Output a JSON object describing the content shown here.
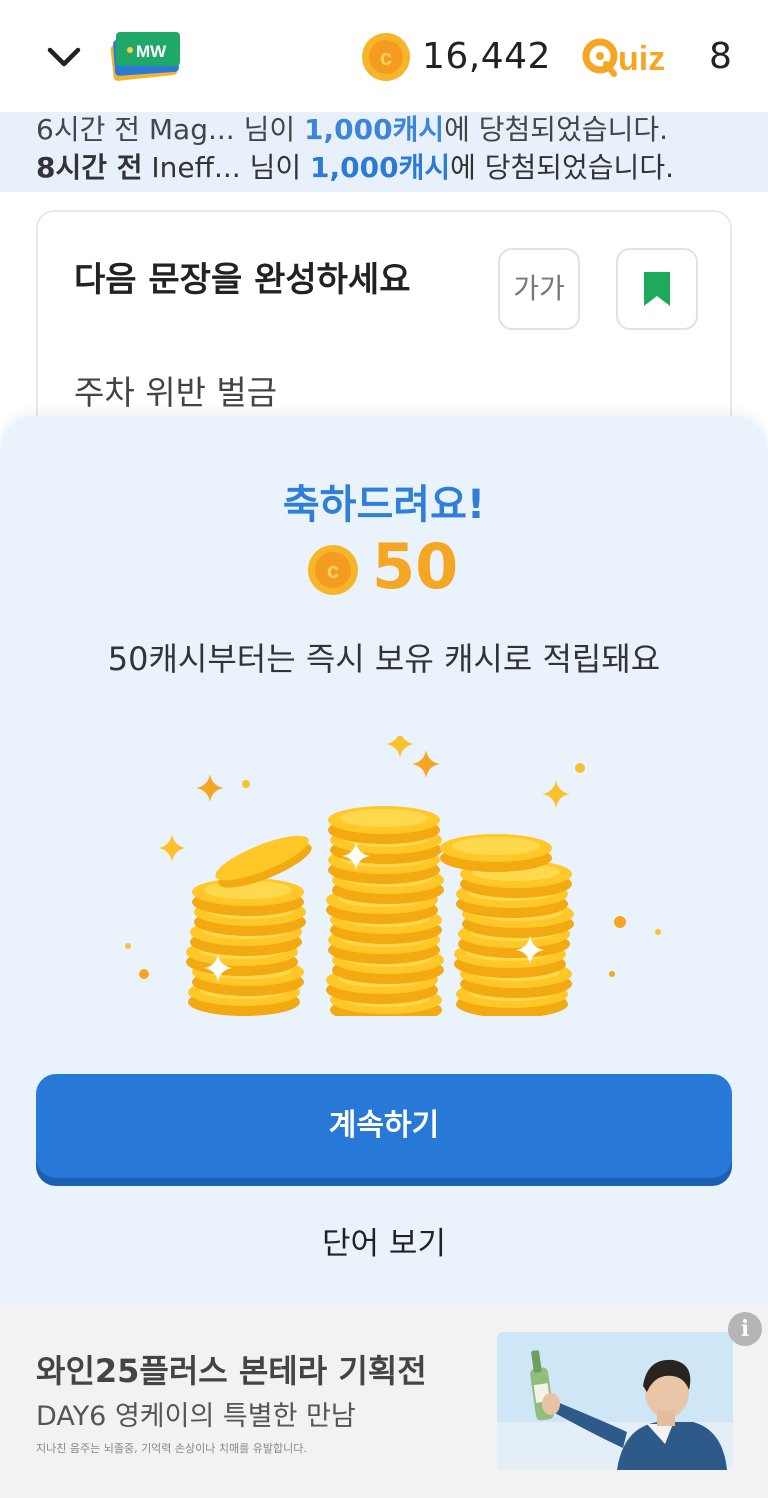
{
  "header": {
    "cash_amount": "16,442",
    "quiz_count": "8",
    "logo_text": "MW",
    "quiz_logo_text": "Quiz",
    "coin_letter": "c"
  },
  "ticker": {
    "line1_prefix": "6시간 전 Mag...",
    "line1_mid": "님이",
    "line1_amount": "1,000캐시",
    "line1_suffix": "에 당첨되었습니다.",
    "line2_time": "8시간 전",
    "line2_user": "Ineff...",
    "line2_mid": "님이",
    "line2_amount": "1,000캐시",
    "line2_suffix": "에 당첨되었습니다."
  },
  "card": {
    "title": "다음 문장을 완성하세요",
    "font_button_label": "가가",
    "sentence": "주차 위반 벌금"
  },
  "reward": {
    "title": "축하드려요!",
    "amount": "50",
    "message": "50캐시부터는 즉시 보유 캐시로 적립돼요",
    "continue_label": "계속하기",
    "view_word_label": "단어 보기"
  },
  "ad": {
    "title": "와인25플러스 본테라 기획전",
    "subtitle": "DAY6 영케이의 특별한 만남",
    "disclaimer": "지나친 음주는 뇌졸중, 기억력 손상이나 치매를 유발합니다.",
    "info_label": "i"
  },
  "colors": {
    "accent_blue": "#2878d8",
    "gold": "#f5a623",
    "sheet_bg": "#eaf3fc",
    "bookmark_green": "#1eaa5a"
  }
}
